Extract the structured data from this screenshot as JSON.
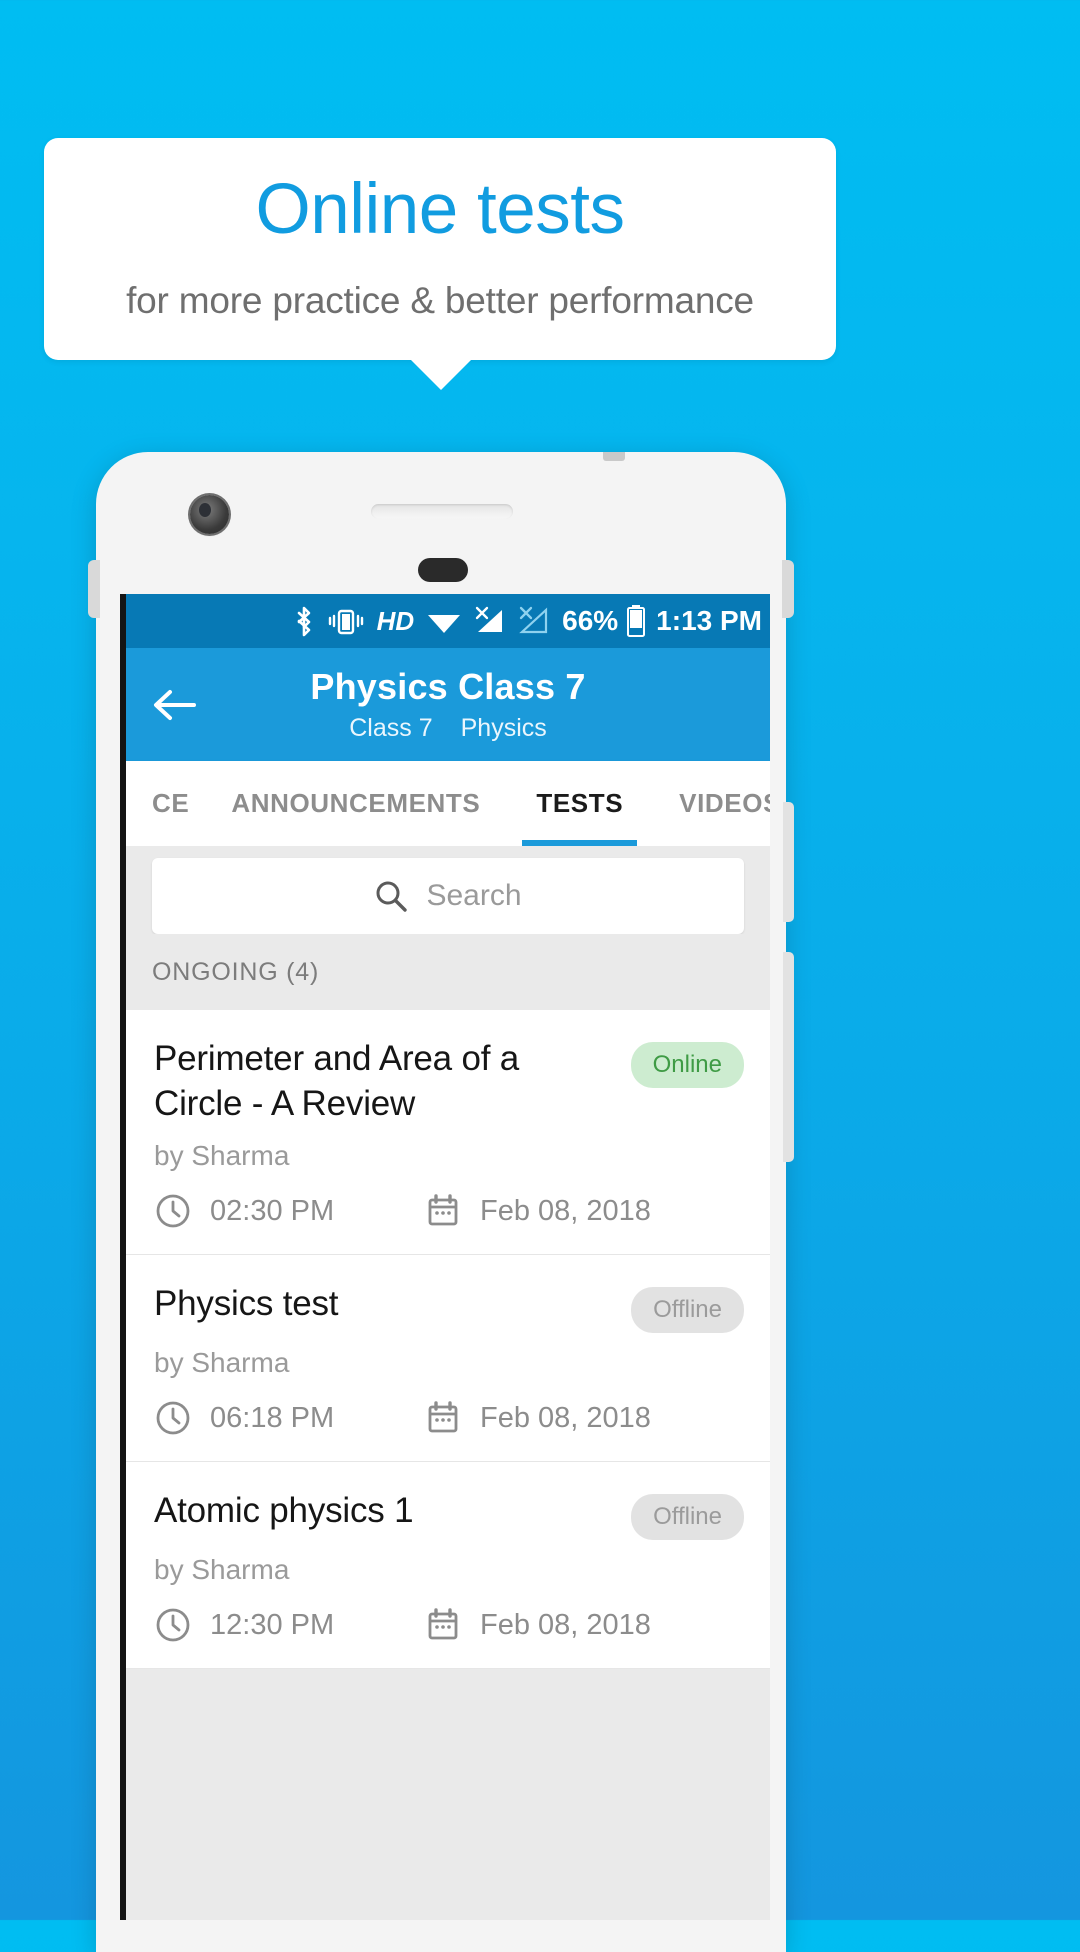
{
  "promo": {
    "title": "Online tests",
    "subtitle": "for more practice & better performance",
    "title_color": "#119ce0",
    "subtitle_color": "#6f6f6f",
    "background_color": "#0aabe9"
  },
  "statusbar": {
    "icons": [
      "bluetooth-icon",
      "vibrate-icon",
      "hd-icon",
      "wifi-icon",
      "signal-no-sim-1-icon",
      "signal-no-sim-2-icon"
    ],
    "hd_label": "HD",
    "battery_percent": "66%",
    "time": "1:13 PM",
    "background_color": "#0779b5"
  },
  "appbar": {
    "back_icon": "back-arrow-icon",
    "title": "Physics Class 7",
    "subtitle_class": "Class 7",
    "subtitle_subject": "Physics",
    "background_color": "#1b9ada"
  },
  "tabs": {
    "items": [
      {
        "label": "CE",
        "active": false
      },
      {
        "label": "ANNOUNCEMENTS",
        "active": false
      },
      {
        "label": "TESTS",
        "active": true
      },
      {
        "label": "VIDEOS",
        "active": false
      }
    ],
    "indicator_color": "#1b9ada"
  },
  "search": {
    "icon": "search-icon",
    "placeholder": "Search",
    "value": ""
  },
  "section": {
    "header": "ONGOING (4)"
  },
  "tests": [
    {
      "title": "Perimeter and Area of a Circle - A Review",
      "author": "by Sharma",
      "status": "Online",
      "status_type": "online",
      "time": "02:30 PM",
      "date": "Feb 08, 2018",
      "time_icon": "clock-icon",
      "date_icon": "calendar-icon"
    },
    {
      "title": "Physics test",
      "author": "by Sharma",
      "status": "Offline",
      "status_type": "offline",
      "time": "06:18 PM",
      "date": "Feb 08, 2018",
      "time_icon": "clock-icon",
      "date_icon": "calendar-icon"
    },
    {
      "title": "Atomic physics 1",
      "author": "by Sharma",
      "status": "Offline",
      "status_type": "offline",
      "time": "12:30 PM",
      "date": "Feb 08, 2018",
      "time_icon": "clock-icon",
      "date_icon": "calendar-icon"
    }
  ],
  "colors": {
    "badge_online_bg": "#cdecd0",
    "badge_online_fg": "#3f9b45",
    "badge_offline_bg": "#e2e2e2",
    "badge_offline_fg": "#9b9b9b"
  }
}
